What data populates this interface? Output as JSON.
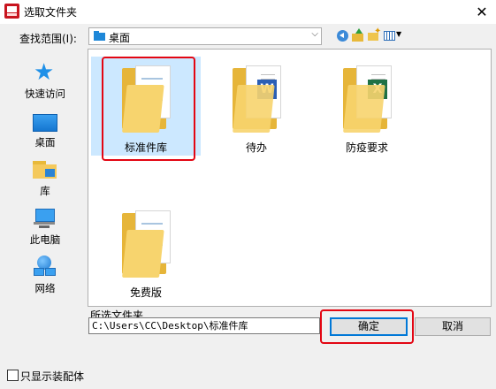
{
  "window": {
    "title": "选取文件夹"
  },
  "toolbar": {
    "lookin_label": "查找范围(I):",
    "lookin_value": "桌面"
  },
  "places": [
    {
      "label": "快速访问",
      "icon": "quick-access-star-icon"
    },
    {
      "label": "桌面",
      "icon": "desktop-icon"
    },
    {
      "label": "库",
      "icon": "library-icon"
    },
    {
      "label": "此电脑",
      "icon": "this-pc-icon"
    },
    {
      "label": "网络",
      "icon": "network-icon"
    }
  ],
  "files": [
    {
      "name": "标准件库",
      "type": "folder",
      "selected": true
    },
    {
      "name": "待办",
      "type": "folder-word"
    },
    {
      "name": "防疫要求",
      "type": "folder-excel"
    },
    {
      "name": "免费版",
      "type": "folder"
    }
  ],
  "bottom": {
    "selected_label": "所选文件夹",
    "path": "C:\\Users\\CC\\Desktop\\标准件库",
    "ok": "确定",
    "cancel": "取消"
  },
  "options": {
    "show_assemblies_label": "只显示装配体"
  },
  "colors": {
    "annotation": "#e30613",
    "selection": "#cce8ff",
    "accent": "#0078d7"
  }
}
